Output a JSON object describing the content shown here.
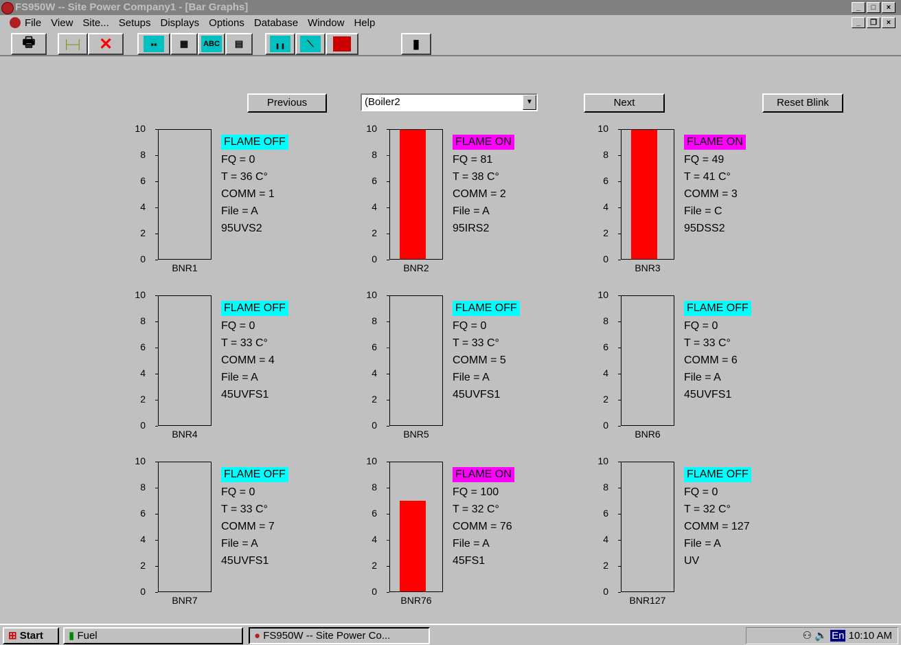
{
  "window": {
    "title": "FS950W -- Site Power Company1 - [Bar Graphs]"
  },
  "menu": [
    "File",
    "View",
    "Site...",
    "Setups",
    "Displays",
    "Options",
    "Database",
    "Window",
    "Help"
  ],
  "toolbar": {
    "abc_label": "ABC"
  },
  "nav": {
    "previous": "Previous",
    "next": "Next",
    "reset": "Reset Blink",
    "selected": "(Boiler2"
  },
  "axis_ticks": [
    "10",
    "8",
    "6",
    "4",
    "2",
    "0"
  ],
  "colors": {
    "flame_off": "#00ffff",
    "flame_on": "#ff00ff",
    "bar": "#ff0000"
  },
  "chart_data": [
    {
      "type": "bar",
      "name": "BNR1",
      "value": 0,
      "ylim": [
        0,
        10
      ],
      "status": "FLAME OFF",
      "fq": "FQ = 0",
      "t": "T = 36 C°",
      "comm": "COMM = 1",
      "file": "File = A",
      "sensor": "95UVS2"
    },
    {
      "type": "bar",
      "name": "BNR2",
      "value": 10,
      "ylim": [
        0,
        10
      ],
      "status": "FLAME ON",
      "fq": "FQ = 81",
      "t": "T = 38 C°",
      "comm": "COMM =  2",
      "file": "File = A",
      "sensor": "95IRS2"
    },
    {
      "type": "bar",
      "name": "BNR3",
      "value": 10,
      "ylim": [
        0,
        10
      ],
      "status": "FLAME ON",
      "fq": "FQ = 49",
      "t": "T = 41 C°",
      "comm": "COMM =  3",
      "file": "File = C",
      "sensor": "95DSS2"
    },
    {
      "type": "bar",
      "name": "BNR4",
      "value": 0,
      "ylim": [
        0,
        10
      ],
      "status": "FLAME OFF",
      "fq": "FQ = 0",
      "t": "T = 33 C°",
      "comm": "COMM =  4",
      "file": "File = A",
      "sensor": "45UVFS1"
    },
    {
      "type": "bar",
      "name": "BNR5",
      "value": 0,
      "ylim": [
        0,
        10
      ],
      "status": "FLAME OFF",
      "fq": "FQ = 0",
      "t": "T = 33 C°",
      "comm": "COMM =  5",
      "file": "File = A",
      "sensor": "45UVFS1"
    },
    {
      "type": "bar",
      "name": "BNR6",
      "value": 0,
      "ylim": [
        0,
        10
      ],
      "status": "FLAME OFF",
      "fq": "FQ = 0",
      "t": "T = 33 C°",
      "comm": "COMM =  6",
      "file": "File = A",
      "sensor": "45UVFS1"
    },
    {
      "type": "bar",
      "name": "BNR7",
      "value": 0,
      "ylim": [
        0,
        10
      ],
      "status": "FLAME OFF",
      "fq": "FQ = 0",
      "t": "T = 33 C°",
      "comm": "COMM =  7",
      "file": "File = A",
      "sensor": "45UVFS1"
    },
    {
      "type": "bar",
      "name": "BNR76",
      "value": 7,
      "ylim": [
        0,
        10
      ],
      "status": "FLAME ON",
      "fq": "FQ = 100",
      "t": "T = 32 C°",
      "comm": "COMM = 76",
      "file": "File = A",
      "sensor": "45FS1"
    },
    {
      "type": "bar",
      "name": "BNR127",
      "value": 0,
      "ylim": [
        0,
        10
      ],
      "status": "FLAME OFF",
      "fq": "FQ = 0",
      "t": "T = 32 C°",
      "comm": "COMM = 127",
      "file": "File = A",
      "sensor": "UV"
    }
  ],
  "taskbar": {
    "start": "Start",
    "fuel": "Fuel",
    "app": "FS950W -- Site Power Co...",
    "lang": "En",
    "clock": "10:10 AM"
  }
}
